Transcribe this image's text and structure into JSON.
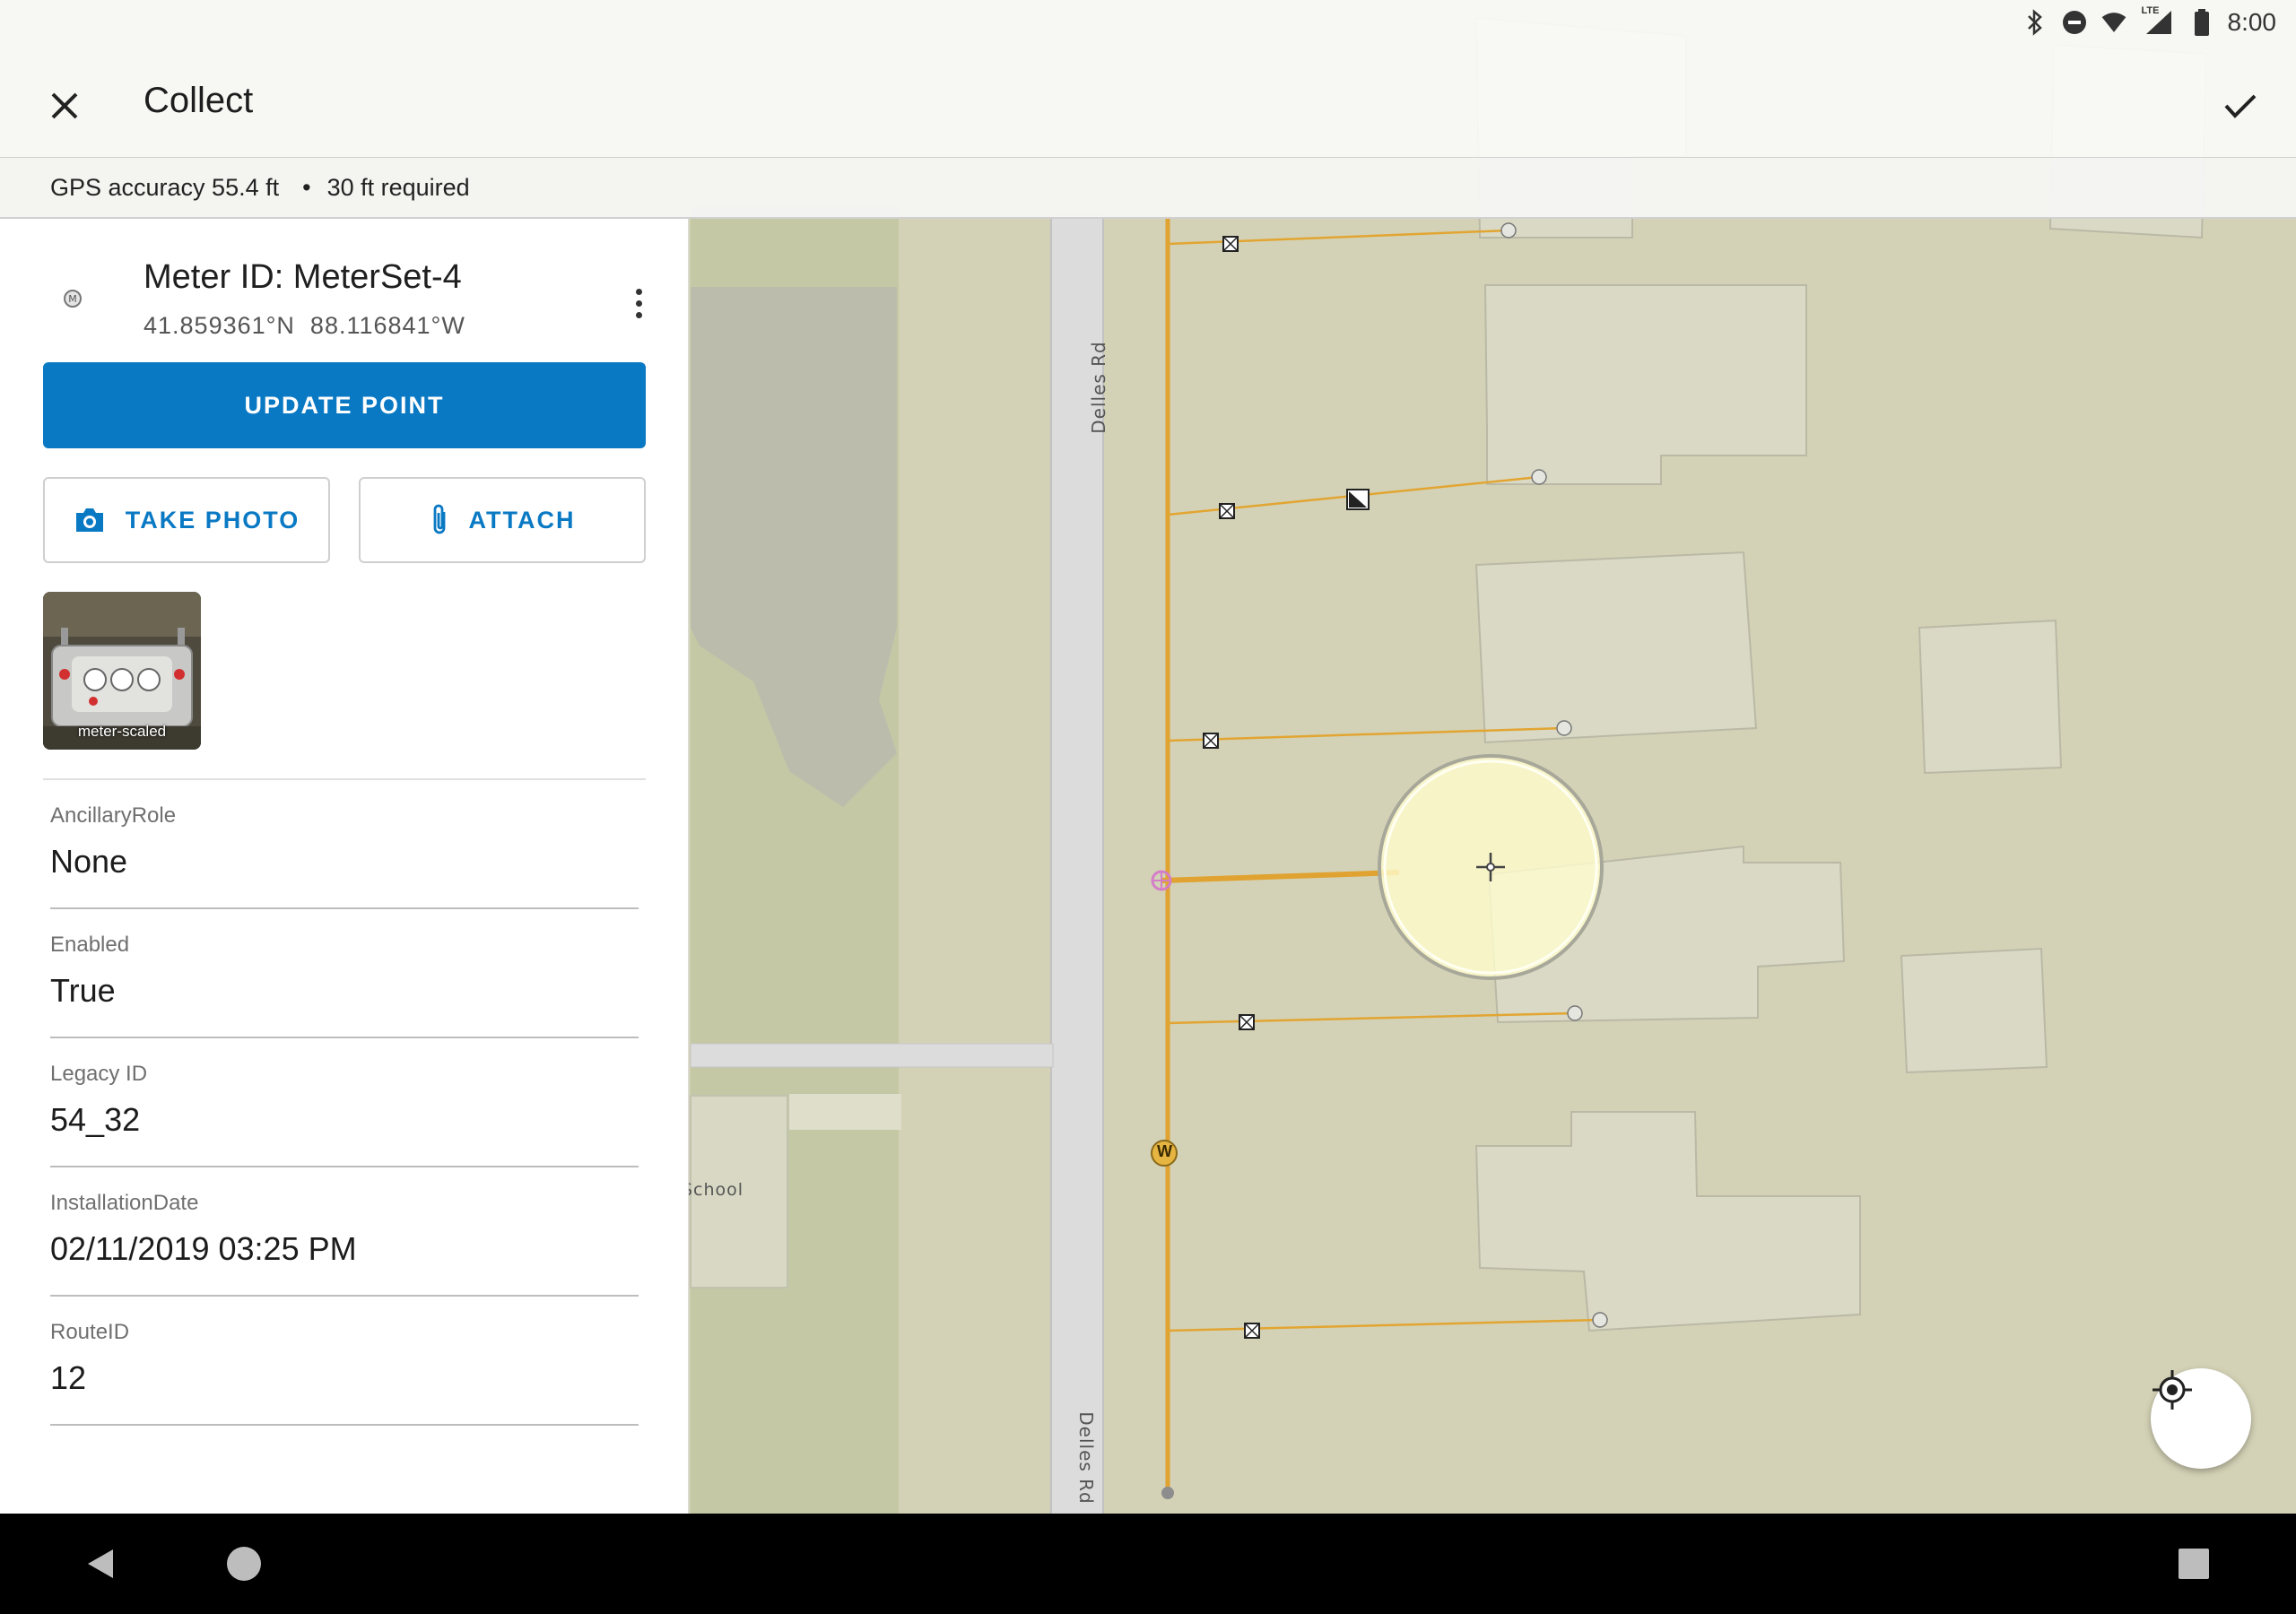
{
  "status_bar": {
    "time": "8:00",
    "network_label": "LTE"
  },
  "app_bar": {
    "title": "Collect"
  },
  "gps": {
    "accuracy_text": "GPS accuracy 55.4 ft",
    "separator": "•",
    "required_text": "30 ft required"
  },
  "feature": {
    "title": "Meter ID: MeterSet-4",
    "coordinates": "41.859361°N  88.116841°W",
    "update_label": "UPDATE POINT",
    "take_photo_label": "TAKE PHOTO",
    "attach_label": "ATTACH",
    "attachment_name": "meter-scaled"
  },
  "fields": [
    {
      "label": "AncillaryRole",
      "value": "None"
    },
    {
      "label": "Enabled",
      "value": "True"
    },
    {
      "label": "Legacy ID",
      "value": "54_32"
    },
    {
      "label": "InstallationDate",
      "value": "02/11/2019 03:25 PM"
    },
    {
      "label": "RouteID",
      "value": "12"
    }
  ],
  "map": {
    "road_label_top": "Delles Rd",
    "road_label_bottom": "Delles Rd",
    "school_label": "School",
    "main_marker_label": "W"
  },
  "colors": {
    "accent": "#0a79c4",
    "map_background": "#d4d2b6",
    "utility_line": "#e0a230",
    "building_fill": "#d9d9c5"
  }
}
